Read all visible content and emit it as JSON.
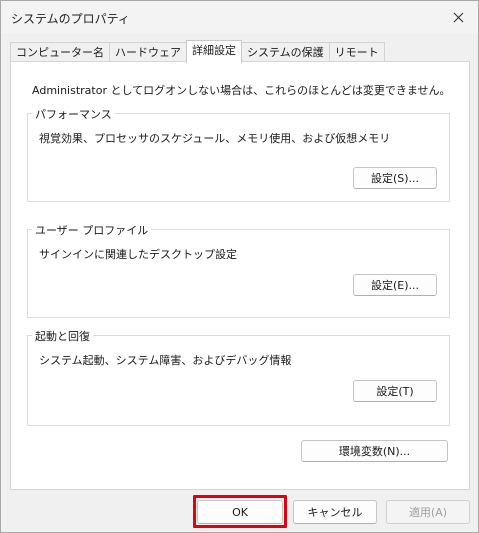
{
  "window": {
    "title": "システムのプロパティ"
  },
  "tabs": [
    {
      "label": "コンピューター名"
    },
    {
      "label": "ハードウェア"
    },
    {
      "label": "詳細設定"
    },
    {
      "label": "システムの保護"
    },
    {
      "label": "リモート"
    }
  ],
  "active_tab": "詳細設定",
  "panel": {
    "intro": "Administrator としてログオンしない場合は、これらのほとんどは変更できません。",
    "performance": {
      "title": "パフォーマンス",
      "description": "視覚効果、プロセッサのスケジュール、メモリ使用、および仮想メモリ",
      "button": "設定(S)..."
    },
    "user_profile": {
      "title": "ユーザー プロファイル",
      "description": "サインインに関連したデスクトップ設定",
      "button": "設定(E)..."
    },
    "startup": {
      "title": "起動と回復",
      "description": "システム起動、システム障害、およびデバッグ情報",
      "button": "設定(T)"
    },
    "env_button": "環境変数(N)..."
  },
  "footer": {
    "ok": "OK",
    "cancel": "キャンセル",
    "apply": "適用(A)"
  },
  "colors": {
    "highlight": "#e2000f"
  }
}
